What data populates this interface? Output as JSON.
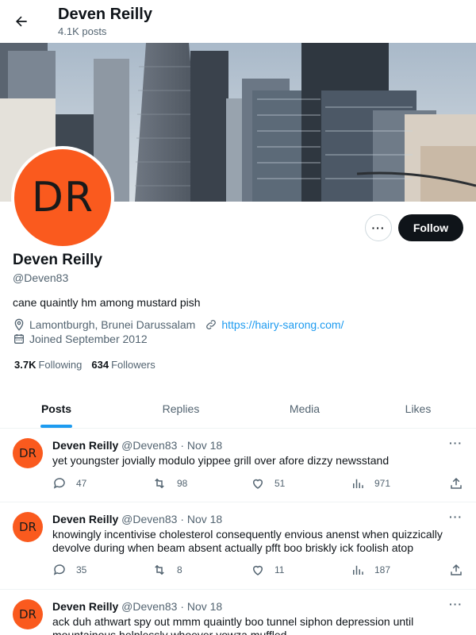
{
  "header": {
    "name": "Deven Reilly",
    "posts_count": "4.1K posts"
  },
  "profile": {
    "avatar_initials": "DR",
    "name": "Deven Reilly",
    "handle": "@Deven83",
    "bio": "cane quaintly hm among mustard pish",
    "location": "Lamontburgh, Brunei Darussalam",
    "website": "https://hairy-sarong.com/",
    "joined": "Joined September 2012",
    "following_count": "3.7K",
    "following_label": "Following",
    "followers_count": "634",
    "followers_label": "Followers",
    "follow_label": "Follow",
    "more_label": "···"
  },
  "tabs": [
    {
      "label": "Posts",
      "active": true
    },
    {
      "label": "Replies",
      "active": false
    },
    {
      "label": "Media",
      "active": false
    },
    {
      "label": "Likes",
      "active": false
    }
  ],
  "posts": [
    {
      "avatar": "DR",
      "name": "Deven Reilly",
      "handle": "@Deven83",
      "time": "· Nov 18",
      "text": "yet youngster jovially modulo yippee grill over afore dizzy newsstand",
      "replies": "47",
      "reposts": "98",
      "likes": "51",
      "views": "971"
    },
    {
      "avatar": "DR",
      "name": "Deven Reilly",
      "handle": "@Deven83",
      "time": "· Nov 18",
      "text": "knowingly incentivise cholesterol consequently envious anenst when quizzically devolve during when beam absent actually pfft boo briskly ick foolish atop",
      "replies": "35",
      "reposts": "8",
      "likes": "11",
      "views": "187"
    },
    {
      "avatar": "DR",
      "name": "Deven Reilly",
      "handle": "@Deven83",
      "time": "· Nov 18",
      "text": "ack duh athwart spy out mmm quaintly boo tunnel siphon depression until mountainous helplessly whoever yowza muffled",
      "replies": "",
      "reposts": "",
      "likes": "",
      "views": ""
    }
  ],
  "colors": {
    "accent": "#1d9bf0",
    "avatar": "#fa5a1e",
    "text": "#0f1419",
    "muted": "#536471"
  },
  "icons": [
    "back-arrow-icon",
    "location-icon",
    "link-icon",
    "calendar-icon",
    "reply-icon",
    "repost-icon",
    "like-icon",
    "views-icon",
    "share-icon"
  ]
}
